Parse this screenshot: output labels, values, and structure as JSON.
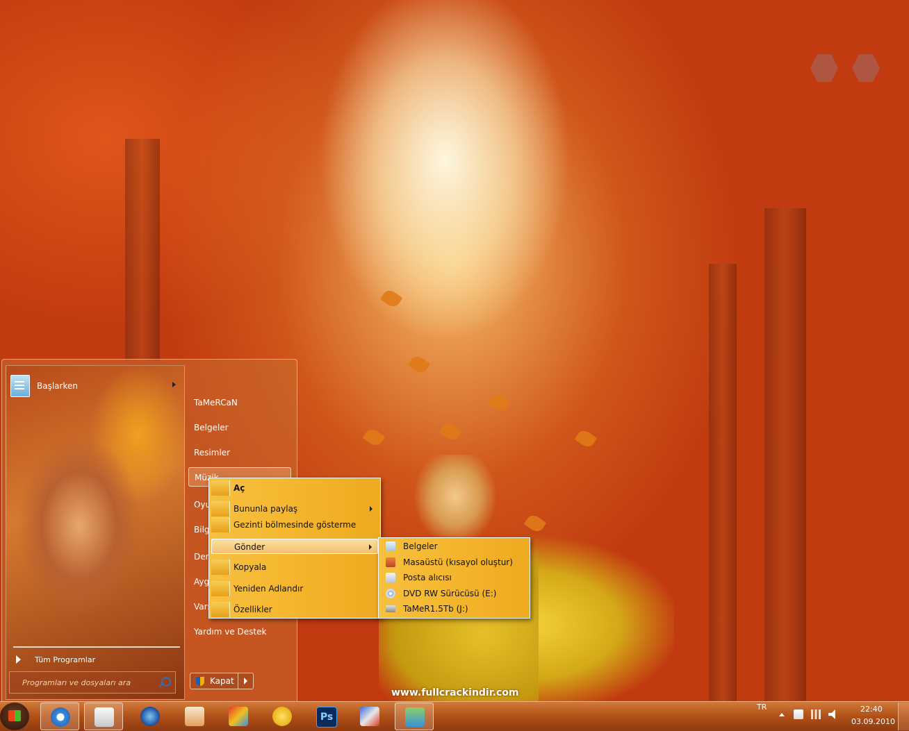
{
  "start_menu": {
    "pinned": {
      "label": "Başlarken"
    },
    "all_programs": "Tüm Programlar",
    "search_placeholder": "Programları ve dosyaları ara",
    "right_items": [
      "TaMeRCaN",
      "Belgeler",
      "Resimler",
      "Müzik",
      "Oyu",
      "Bilg",
      "Den",
      "Ayg",
      "Vars",
      "Yardım ve Destek"
    ],
    "shutdown_label": "Kapat"
  },
  "context_menu": {
    "items": [
      "Aç",
      "Bununla paylaş",
      "Gezinti bölmesinde gösterme",
      "Gönder",
      "Kopyala",
      "Yeniden Adlandır",
      "Özellikler"
    ]
  },
  "send_to_menu": {
    "items": [
      "Belgeler",
      "Masaüstü (kısayol oluştur)",
      "Posta alıcısı",
      "DVD RW Sürücüsü (E:)",
      "TaMeR1.5Tb (J:)"
    ]
  },
  "watermark": "www.fullcrackindir.com",
  "taskbar": {
    "apps": [
      "internet-explorer-icon",
      "windows-explorer-icon",
      "media-player-icon",
      "image-viewer-icon",
      "paint-icon",
      "flash-icon",
      "photoshop-icon",
      "tools-icon",
      "user-accounts-icon"
    ],
    "photoshop_label": "Ps",
    "language": "TR",
    "time": "22:40",
    "date": "03.09.2010"
  },
  "colors": {
    "menu_bg": "#f5b830",
    "taskbar": "#b05018",
    "accent": "#e07a18"
  }
}
